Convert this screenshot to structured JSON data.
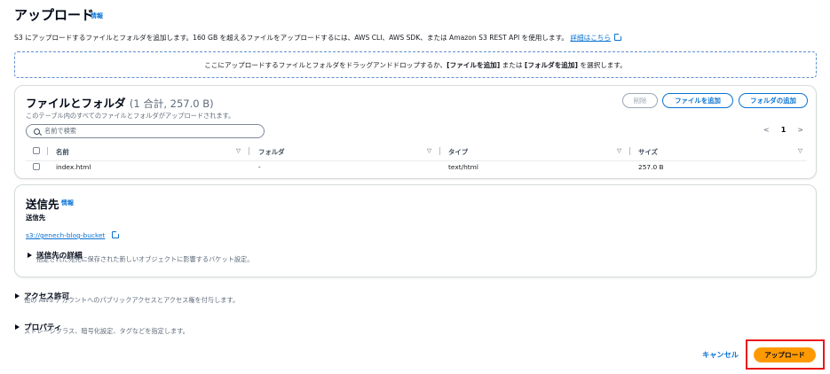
{
  "header": {
    "title": "アップロード",
    "info": "情報",
    "description_prefix": "S3 にアップロードするファイルとフォルダを追加します。160 GB を超えるファイルをアップロードするには、AWS CLI、AWS SDK、または Amazon S3 REST API を使用します。",
    "learn_more": "詳細はこちら"
  },
  "dropzone": {
    "prefix": "ここにアップロードするファイルとフォルダをドラッグアンドドロップするか、",
    "add_files": "[ファイルを追加]",
    "middle": " または ",
    "add_folder": "[フォルダを追加]",
    "suffix": " を選択します。"
  },
  "files_panel": {
    "title": "ファイルとフォルダ",
    "count": "(1 合計, 257.0 B)",
    "subtitle": "このテーブル内のすべてのファイルとフォルダがアップロードされます。",
    "remove_label": "削除",
    "add_files_label": "ファイルを追加",
    "add_folder_label": "フォルダの追加",
    "search_placeholder": "名前で検索",
    "pager": {
      "prev": "<",
      "current": "1",
      "next": ">"
    },
    "columns": [
      "名前",
      "フォルダ",
      "タイプ",
      "サイズ"
    ],
    "rows": [
      {
        "name": "index.html",
        "folder": "-",
        "type": "text/html",
        "size": "257.0 B"
      }
    ]
  },
  "destination": {
    "title": "送信先",
    "info": "情報",
    "label": "送信先",
    "bucket": "s3://genech-blog-bucket",
    "details_title": "送信先の詳細",
    "details_desc": "指定された宛先に保存された新しいオブジェクトに影響するバケット設定。"
  },
  "permissions": {
    "title": "アクセス許可",
    "desc": "他の AWS アカウントへのパブリックアクセスとアクセス権を付与します。"
  },
  "properties": {
    "title": "プロパティ",
    "desc": "ストレージクラス、暗号化設定、タグなどを指定します。"
  },
  "footer": {
    "cancel_label": "キャンセル",
    "upload_label": "アップロード"
  },
  "colors": {
    "link": "#0972d3",
    "primary_button": "#ff9900",
    "highlight": "#e8161d"
  }
}
